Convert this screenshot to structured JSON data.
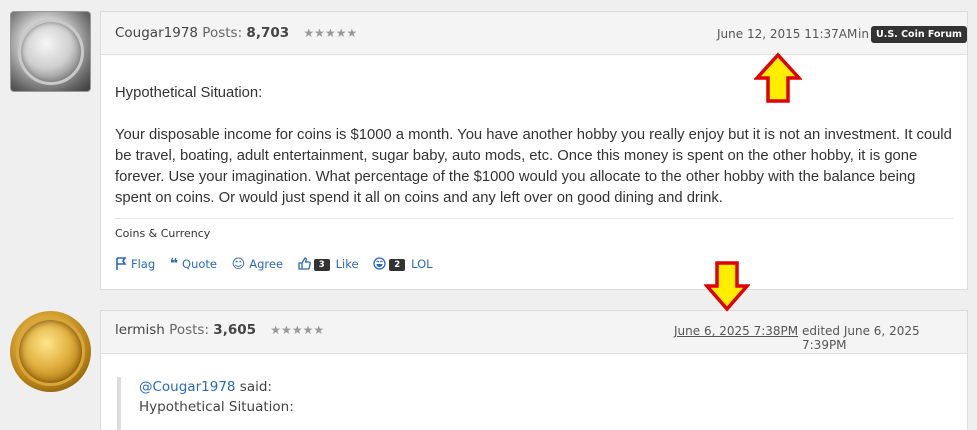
{
  "post1": {
    "username": "Cougar1978",
    "posts_label": "Posts:",
    "posts_count": "8,703",
    "stars": "★★★★★",
    "date": "June 12, 2015 11:37AM",
    "in_label": "in",
    "category": "U.S. Coin Forum",
    "body_p1": "Hypothetical Situation:",
    "body_p2": "Your disposable income for coins is $1000 a month. You have another hobby you really enjoy but it is not an investment. It could be travel, boating, adult entertainment, sugar baby, auto mods, etc. Once this money is spent on the other hobby, it is gone forever. Use your imagination. What percentage of the $1000 would you allocate to the other hobby with the balance being spent on coins. Or would just spend it all on coins and any left over on good dining and drink.",
    "tag": "Coins & Currency",
    "reactions": {
      "flag": "Flag",
      "quote": "Quote",
      "agree": "Agree",
      "like_count": "3",
      "like": "Like",
      "lol_count": "2",
      "lol": "LOL"
    }
  },
  "post2": {
    "username": "lermish",
    "posts_label": "Posts:",
    "posts_count": "3,605",
    "stars": "★★★★★",
    "date": "June 6, 2025 7:38PM",
    "edited": "edited June 6, 2025 7:39PM",
    "quote_author": "@Cougar1978",
    "quote_said": "said:",
    "quote_text": "Hypothetical Situation:"
  },
  "annotation_colors": {
    "arrow_fill": "#ffee00",
    "arrow_stroke": "#e00000"
  },
  "icons": [
    "flag-icon",
    "quote-icon",
    "smiley-icon",
    "thumbs-up-icon",
    "laugh-icon"
  ]
}
